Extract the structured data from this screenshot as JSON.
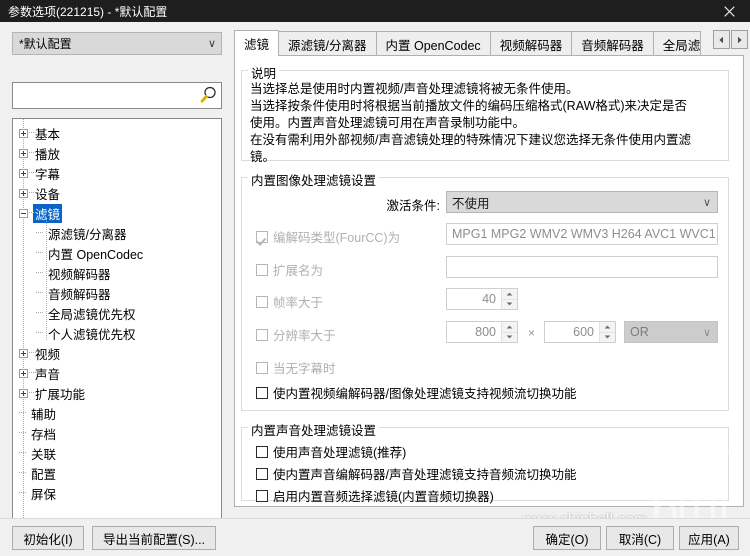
{
  "window": {
    "title": "参数选项(221215) - *默认配置",
    "close_icon": "close-icon"
  },
  "sidebar": {
    "profile_combo": {
      "value": "*默认配置",
      "chevron": "∨"
    },
    "search": {
      "value": "",
      "placeholder": "",
      "icon": "search-icon"
    },
    "tree": [
      {
        "label": "基本",
        "level": 0,
        "toggle": "plus",
        "selected": false
      },
      {
        "label": "播放",
        "level": 0,
        "toggle": "plus",
        "selected": false
      },
      {
        "label": "字幕",
        "level": 0,
        "toggle": "plus",
        "selected": false
      },
      {
        "label": "设备",
        "level": 0,
        "toggle": "plus",
        "selected": false
      },
      {
        "label": "滤镜",
        "level": 0,
        "toggle": "minus",
        "selected": true
      },
      {
        "label": "源滤镜/分离器",
        "level": 1,
        "toggle": "none",
        "selected": false
      },
      {
        "label": "内置 OpenCodec",
        "level": 1,
        "toggle": "none",
        "selected": false
      },
      {
        "label": "视频解码器",
        "level": 1,
        "toggle": "none",
        "selected": false
      },
      {
        "label": "音频解码器",
        "level": 1,
        "toggle": "none",
        "selected": false
      },
      {
        "label": "全局滤镜优先权",
        "level": 1,
        "toggle": "none",
        "selected": false
      },
      {
        "label": "个人滤镜优先权",
        "level": 1,
        "toggle": "none",
        "selected": false
      },
      {
        "label": "视频",
        "level": 0,
        "toggle": "plus",
        "selected": false
      },
      {
        "label": "声音",
        "level": 0,
        "toggle": "plus",
        "selected": false
      },
      {
        "label": "扩展功能",
        "level": 0,
        "toggle": "plus",
        "selected": false
      },
      {
        "label": "辅助",
        "level": 0,
        "toggle": "none",
        "selected": false
      },
      {
        "label": "存档",
        "level": 0,
        "toggle": "none",
        "selected": false
      },
      {
        "label": "关联",
        "level": 0,
        "toggle": "none",
        "selected": false
      },
      {
        "label": "配置",
        "level": 0,
        "toggle": "none",
        "selected": false
      },
      {
        "label": "屏保",
        "level": 0,
        "toggle": "none",
        "selected": false
      }
    ]
  },
  "tabs": {
    "items": [
      {
        "label": "滤镜",
        "active": true
      },
      {
        "label": "源滤镜/分离器",
        "active": false
      },
      {
        "label": "内置 OpenCodec",
        "active": false
      },
      {
        "label": "视频解码器",
        "active": false
      },
      {
        "label": "音频解码器",
        "active": false
      },
      {
        "label": "全局滤",
        "active": false
      }
    ],
    "scroll_left_icon": "triangle-left-icon",
    "scroll_right_icon": "triangle-right-icon"
  },
  "description_group": {
    "legend": "说明",
    "lines": [
      "当选择总是使用时内置视频/声音处理滤镜将被无条件使用。",
      "当选择按条件使用时将根据当前播放文件的编码压缩格式(RAW格式)来决定是否",
      "使用。内置声音处理滤镜可用在声音录制功能中。",
      "在没有需利用外部视频/声音滤镜处理的特殊情况下建议您选择无条件使用内置滤",
      "镜。"
    ]
  },
  "video_filter_group": {
    "legend": "内置图像处理滤镜设置",
    "activation_label": "激活条件:",
    "activation_value": "不使用",
    "activation_chevron": "∨",
    "fourcc": {
      "label": "编解码类型(FourCC)为",
      "checked": true,
      "disabled": true,
      "value": "MPG1 MPG2 WMV2 WMV3 H264 AVC1 WVC1"
    },
    "extension": {
      "label": "扩展名为",
      "checked": false,
      "disabled": true,
      "value": ""
    },
    "framerate": {
      "label": "帧率大于",
      "checked": false,
      "disabled": true,
      "value": "40"
    },
    "resolution": {
      "label": "分辨率大于",
      "checked": false,
      "disabled": true,
      "width": "800",
      "height": "600",
      "separator": "×",
      "operator": "OR",
      "operator_chevron": "∨"
    },
    "no_subtitle": {
      "label": "当无字幕时",
      "checked": false,
      "disabled": true
    },
    "stream_switch": {
      "label": "使内置视频编解码器/图像处理滤镜支持视频流切换功能",
      "checked": false,
      "disabled": false
    }
  },
  "audio_filter_group": {
    "legend": "内置声音处理滤镜设置",
    "options": [
      {
        "label": "使用声音处理滤镜(推荐)",
        "checked": false
      },
      {
        "label": "使内置声音编解码器/声音处理滤镜支持音频流切换功能",
        "checked": false
      },
      {
        "label": "启用内置音频选择滤镜(内置音频切换器)",
        "checked": false
      }
    ]
  },
  "footer": {
    "initialize_label": "初始化(I)",
    "export_label": "导出当前配置(S)...",
    "ok_label": "确定(O)",
    "cancel_label": "取消(C)",
    "apply_label": "应用(A)"
  },
  "watermark": {
    "text": "www.chiphell.com",
    "logo": "chiphell-logo"
  },
  "colors": {
    "titlebar": "#1e1e1e",
    "selection": "#0a64c8",
    "window_bg": "#f0f0f0",
    "panel_bg": "#ffffff"
  }
}
